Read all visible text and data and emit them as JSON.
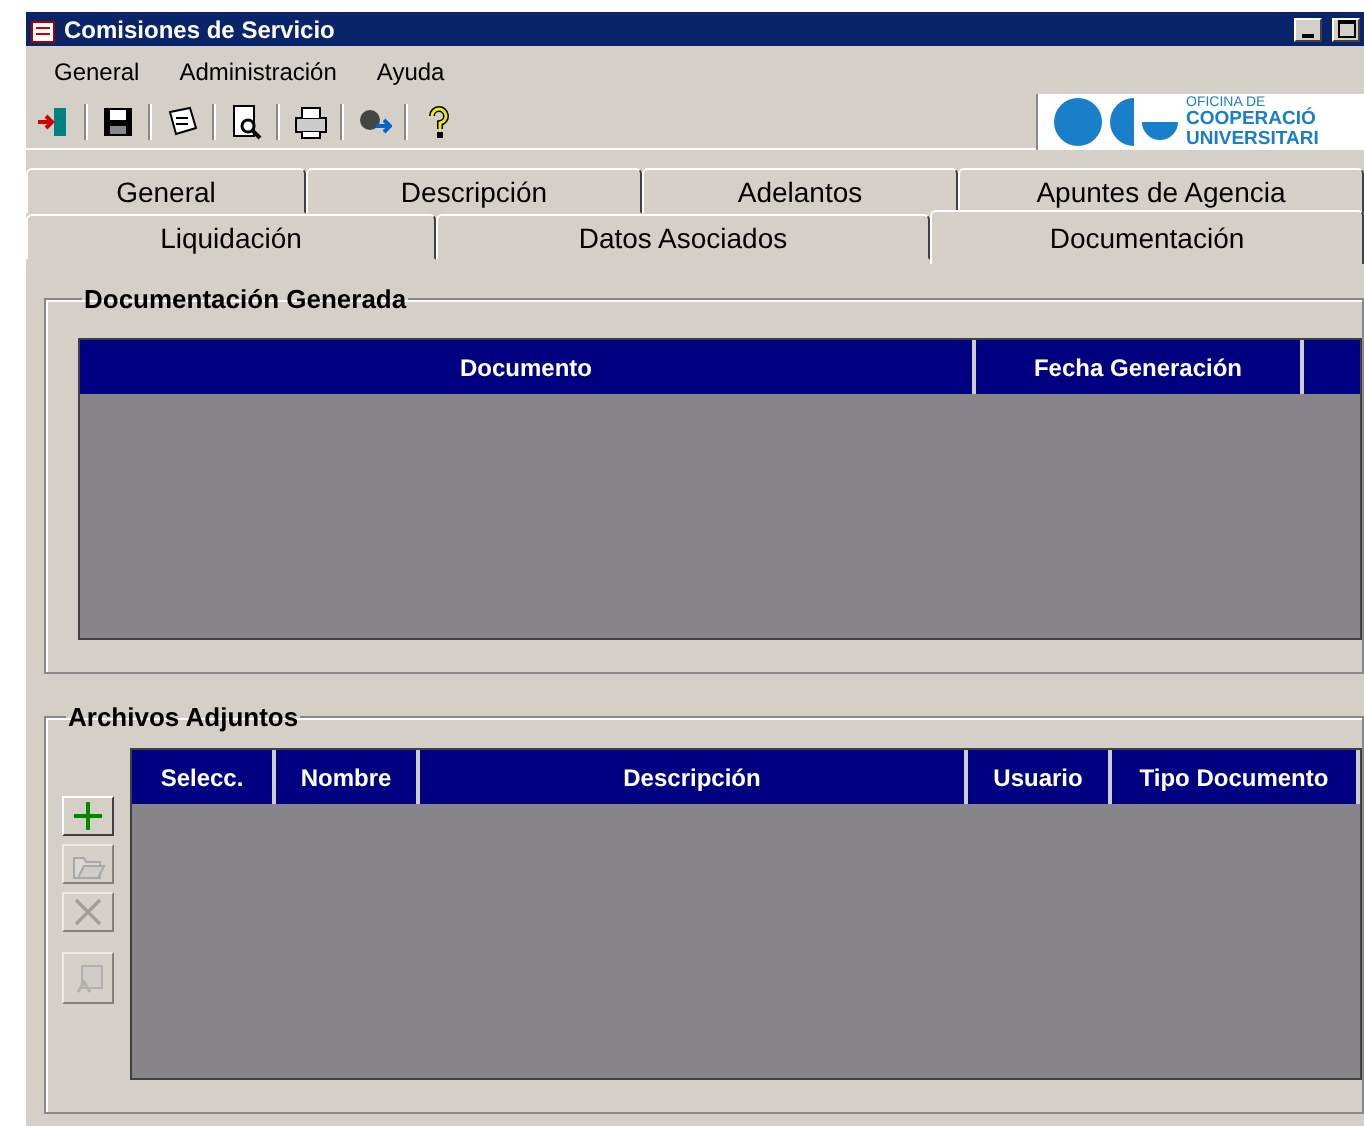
{
  "window": {
    "title": "Comisiones de Servicio"
  },
  "menu": [
    "General",
    "Administración",
    "Ayuda"
  ],
  "toolbar": [
    {
      "kind": "exit"
    },
    {
      "kind": "save"
    },
    {
      "kind": "notes"
    },
    {
      "kind": "preview"
    },
    {
      "kind": "print"
    },
    {
      "kind": "user"
    },
    {
      "kind": "help"
    }
  ],
  "logo": {
    "lines": [
      "OFICINA DE",
      "COOPERACIÓ",
      "UNIVERSITARI"
    ]
  },
  "tabs": [
    [
      {
        "label": "General",
        "selected": false
      },
      {
        "label": "Descripción",
        "selected": false
      },
      {
        "label": "Adelantos",
        "selected": false
      },
      {
        "label": "Apuntes de Agencia",
        "selected": false
      }
    ],
    [
      {
        "label": "Liquidación",
        "selected": false
      },
      {
        "label": "Datos Asociados",
        "selected": false
      },
      {
        "label": "Documentación",
        "selected": true
      }
    ]
  ],
  "generated": {
    "title": "Documentación Generada",
    "columns": [
      "Documento",
      "Fecha Generación"
    ]
  },
  "attachments": {
    "title": "Archivos Adjuntos",
    "columns": [
      "Selecc.",
      "Nombre",
      "Descripción",
      "Usuario",
      "Tipo Documento"
    ],
    "buttons": [
      {
        "kind": "add",
        "disabled": false
      },
      {
        "kind": "open",
        "disabled": true
      },
      {
        "kind": "delete",
        "disabled": true
      },
      {
        "kind": "download",
        "disabled": true
      }
    ]
  }
}
